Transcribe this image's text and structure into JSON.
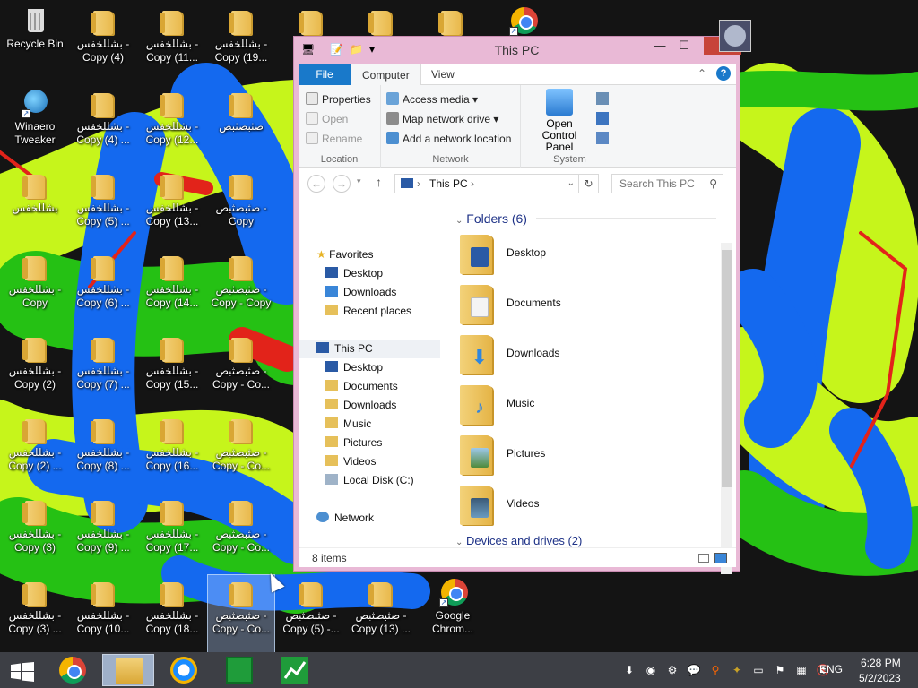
{
  "desktop": {
    "icons": [
      {
        "label": "Recycle Bin"
      },
      {
        "label": "بشللخفس - Copy (4)"
      },
      {
        "label": "بشللخفس - Copy (11..."
      },
      {
        "label": "بشللخفس - Copy (19..."
      },
      {
        "label": "Winaero Tweaker"
      },
      {
        "label": "بشللخفس - Copy (4) ..."
      },
      {
        "label": "بشللخفس - Copy (12..."
      },
      {
        "label": "صثبصثبص"
      },
      {
        "label": "بشللخفس"
      },
      {
        "label": "بشللخفس - Copy (5) ..."
      },
      {
        "label": "بشللخفس - Copy (13..."
      },
      {
        "label": "صثبصثبص - Copy"
      },
      {
        "label": "بشللخفس - Copy"
      },
      {
        "label": "بشللخفس - Copy (6) ..."
      },
      {
        "label": "بشللخفس - Copy (14..."
      },
      {
        "label": "صثبصثبص - Copy - Copy"
      },
      {
        "label": "بشللخفس - Copy (2)"
      },
      {
        "label": "بشللخفس - Copy (7) ..."
      },
      {
        "label": "بشللخفس - Copy (15..."
      },
      {
        "label": "صثبصثبص - Copy - Co..."
      },
      {
        "label": "بشللخفس - Copy (2) ..."
      },
      {
        "label": "بشللخفس - Copy (8) ..."
      },
      {
        "label": "بشللخفس - Copy (16..."
      },
      {
        "label": "صثبصثبص - Copy - Co..."
      },
      {
        "label": "بشللخفس - Copy (3)"
      },
      {
        "label": "بشللخفس - Copy (9) ..."
      },
      {
        "label": "بشللخفس - Copy (17..."
      },
      {
        "label": "صثبصثبص - Copy - Co..."
      },
      {
        "label": "بشللخفس - Copy (3) ..."
      },
      {
        "label": "بشللخفس - Copy (10..."
      },
      {
        "label": "بشللخفس - Copy (18..."
      },
      {
        "label": "صثبصثبص - Copy - Co..."
      },
      {
        "label": "صثبصثبص - Copy (5) -..."
      },
      {
        "label": "صثبصثبص - Copy (13) ..."
      },
      {
        "label": "Google Chrom..."
      }
    ]
  },
  "explorer": {
    "title": "This PC",
    "tabs": {
      "file": "File",
      "computer": "Computer",
      "view": "View"
    },
    "ribbon": {
      "location": {
        "label": "Location",
        "properties": "Properties",
        "open": "Open",
        "rename": "Rename"
      },
      "network": {
        "label": "Network",
        "access_media": "Access media",
        "map_drive": "Map network drive",
        "add_location": "Add a network location"
      },
      "system": {
        "label": "System",
        "open_cp_line1": "Open Control",
        "open_cp_line2": "Panel"
      }
    },
    "address": {
      "path": "This PC",
      "search_placeholder": "Search This PC"
    },
    "nav": {
      "favorites": "Favorites",
      "fav_items": [
        "Desktop",
        "Downloads",
        "Recent places"
      ],
      "this_pc": "This PC",
      "pc_items": [
        "Desktop",
        "Documents",
        "Downloads",
        "Music",
        "Pictures",
        "Videos",
        "Local Disk (C:)"
      ],
      "network": "Network"
    },
    "content": {
      "folders_header": "Folders (6)",
      "folders": [
        "Desktop",
        "Documents",
        "Downloads",
        "Music",
        "Pictures",
        "Videos"
      ],
      "devices_header": "Devices and drives (2)"
    },
    "status": "8 items"
  },
  "taskbar": {
    "lang": "ENG",
    "time": "6:28 PM",
    "date": "5/2/2023"
  },
  "colors": {
    "window_frame": "#e9b9d6",
    "ribbon_file_tab": "#1979ca",
    "close_button": "#c7443a",
    "taskbar": "#3d3f45",
    "wallpaper_green": "#25c114",
    "wallpaper_blue": "#1469ef",
    "wallpaper_lime": "#c6f51b",
    "wallpaper_red": "#e2231a"
  }
}
